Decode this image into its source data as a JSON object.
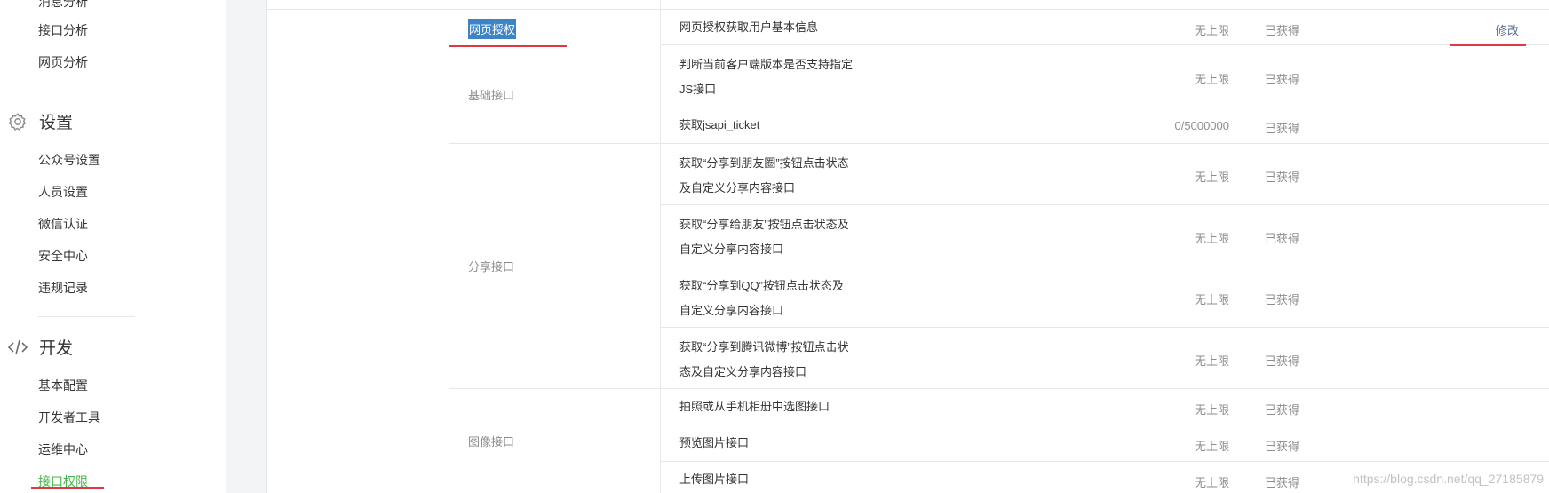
{
  "sidebar": {
    "top_items": [
      "消息分析",
      "接口分析",
      "网页分析"
    ],
    "settings": {
      "title": "设置",
      "items": [
        "公众号设置",
        "人员设置",
        "微信认证",
        "安全中心",
        "违规记录"
      ]
    },
    "dev": {
      "title": "开发",
      "items": [
        "基本配置",
        "开发者工具",
        "运维中心",
        "接口权限"
      ]
    }
  },
  "table": {
    "highlight_label": "网页授权",
    "rows": [
      {
        "name": "网页授权获取用户基本信息",
        "quota": "无上限",
        "status": "已获得",
        "action": "修改"
      },
      {
        "name": "判断当前客户端版本是否支持指定JS接口",
        "quota": "无上限",
        "status": "已获得",
        "action": ""
      },
      {
        "name": "获取jsapi_ticket",
        "quota": "0/5000000",
        "status": "已获得",
        "action": ""
      },
      {
        "name": "获取“分享到朋友圈”按钮点击状态及自定义分享内容接口",
        "quota": "无上限",
        "status": "已获得",
        "action": ""
      },
      {
        "name": "获取“分享给朋友”按钮点击状态及自定义分享内容接口",
        "quota": "无上限",
        "status": "已获得",
        "action": ""
      },
      {
        "name": "获取“分享到QQ”按钮点击状态及自定义分享内容接口",
        "quota": "无上限",
        "status": "已获得",
        "action": ""
      },
      {
        "name": "获取“分享到腾讯微博”按钮点击状态及自定义分享内容接口",
        "quota": "无上限",
        "status": "已获得",
        "action": ""
      },
      {
        "name": "拍照或从手机相册中选图接口",
        "quota": "无上限",
        "status": "已获得",
        "action": ""
      },
      {
        "name": "预览图片接口",
        "quota": "无上限",
        "status": "已获得",
        "action": ""
      },
      {
        "name": "上传图片接口",
        "quota": "无上限",
        "status": "已获得",
        "action": ""
      }
    ],
    "groups": [
      "基础接口",
      "分享接口",
      "图像接口"
    ]
  },
  "watermark": "https://blog.csdn.net/qq_27185879",
  "colors": {
    "active": "#44b549",
    "link": "#576b95",
    "annotation": "#e0383e",
    "highlight": "#3d84c6"
  }
}
